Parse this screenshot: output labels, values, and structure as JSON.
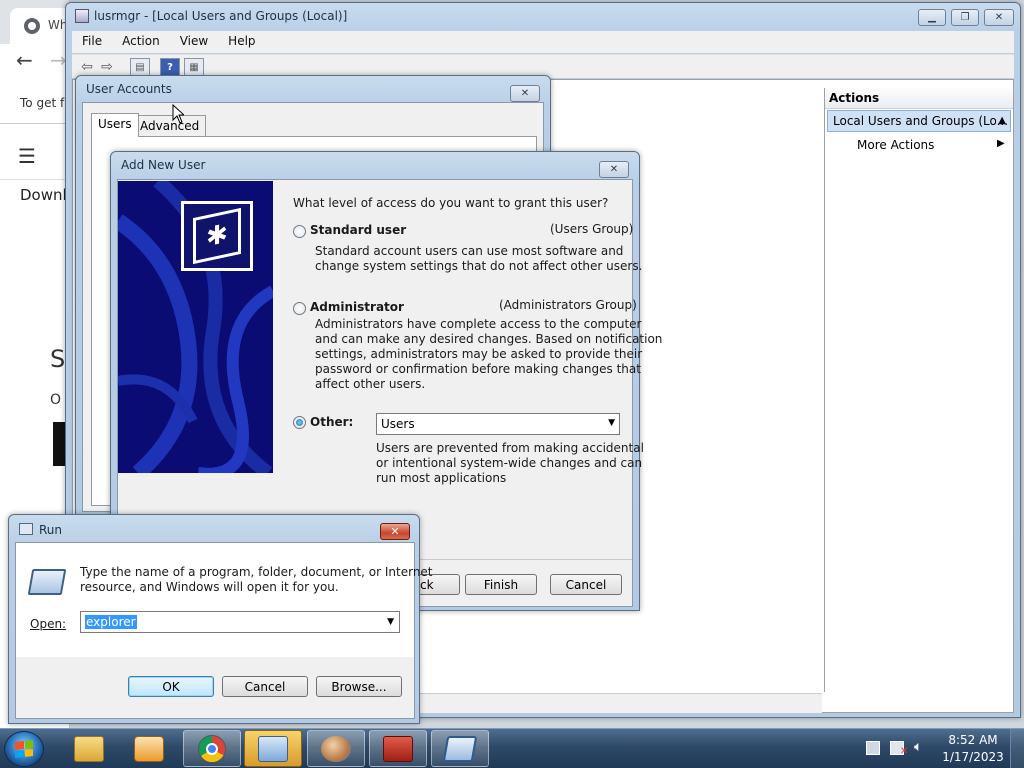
{
  "chrome": {
    "tab_text": "Wh",
    "hint_text": "To get f",
    "download_text": "Downl",
    "big_letter": "S",
    "small_text": "O"
  },
  "mmc": {
    "title": "lusrmgr - [Local Users and Groups (Local)]",
    "menu": [
      "File",
      "Action",
      "View",
      "Help"
    ],
    "actions_header": "Actions",
    "actions_selected": "Local Users and Groups (Lo...",
    "more_actions": "More Actions"
  },
  "user_accounts": {
    "title": "User Accounts",
    "tabs": [
      "Users",
      "Advanced"
    ]
  },
  "add_new_user": {
    "title": "Add New User",
    "question": "What level of access do you want to grant this user?",
    "standard": {
      "label": "Standard user",
      "group": "(Users Group)",
      "desc": [
        "Standard account users can use most software and",
        "change system settings that do not affect other users."
      ]
    },
    "admin": {
      "label": "Administrator",
      "group": "(Administrators Group)",
      "desc": [
        "Administrators have complete access to the computer",
        "and can make any desired changes. Based on notification",
        "settings, administrators may be asked to provide their",
        "password or confirmation before making changes that",
        "affect other users."
      ]
    },
    "other": {
      "label": "Other:",
      "selected_value": "Users",
      "desc": [
        "Users are prevented from making accidental",
        "or intentional system-wide changes and can",
        "run most applications"
      ]
    },
    "buttons": {
      "back": "Back",
      "finish": "Finish",
      "cancel": "Cancel"
    }
  },
  "run": {
    "title": "Run",
    "desc": [
      "Type the name of a program, folder, document, or Internet",
      "resource, and Windows will open it for you."
    ],
    "open_label": "Open:",
    "input_value": "explorer",
    "buttons": {
      "ok": "OK",
      "cancel": "Cancel",
      "browse": "Browse..."
    }
  },
  "taskbar": {
    "time": "8:52 AM",
    "date": "1/17/2023"
  },
  "colors": {
    "taskbar": "#2e4a68",
    "dialog_bg": "#f0f0f0",
    "wizard_side": "#0a0c74",
    "selection": "#3399ff"
  }
}
